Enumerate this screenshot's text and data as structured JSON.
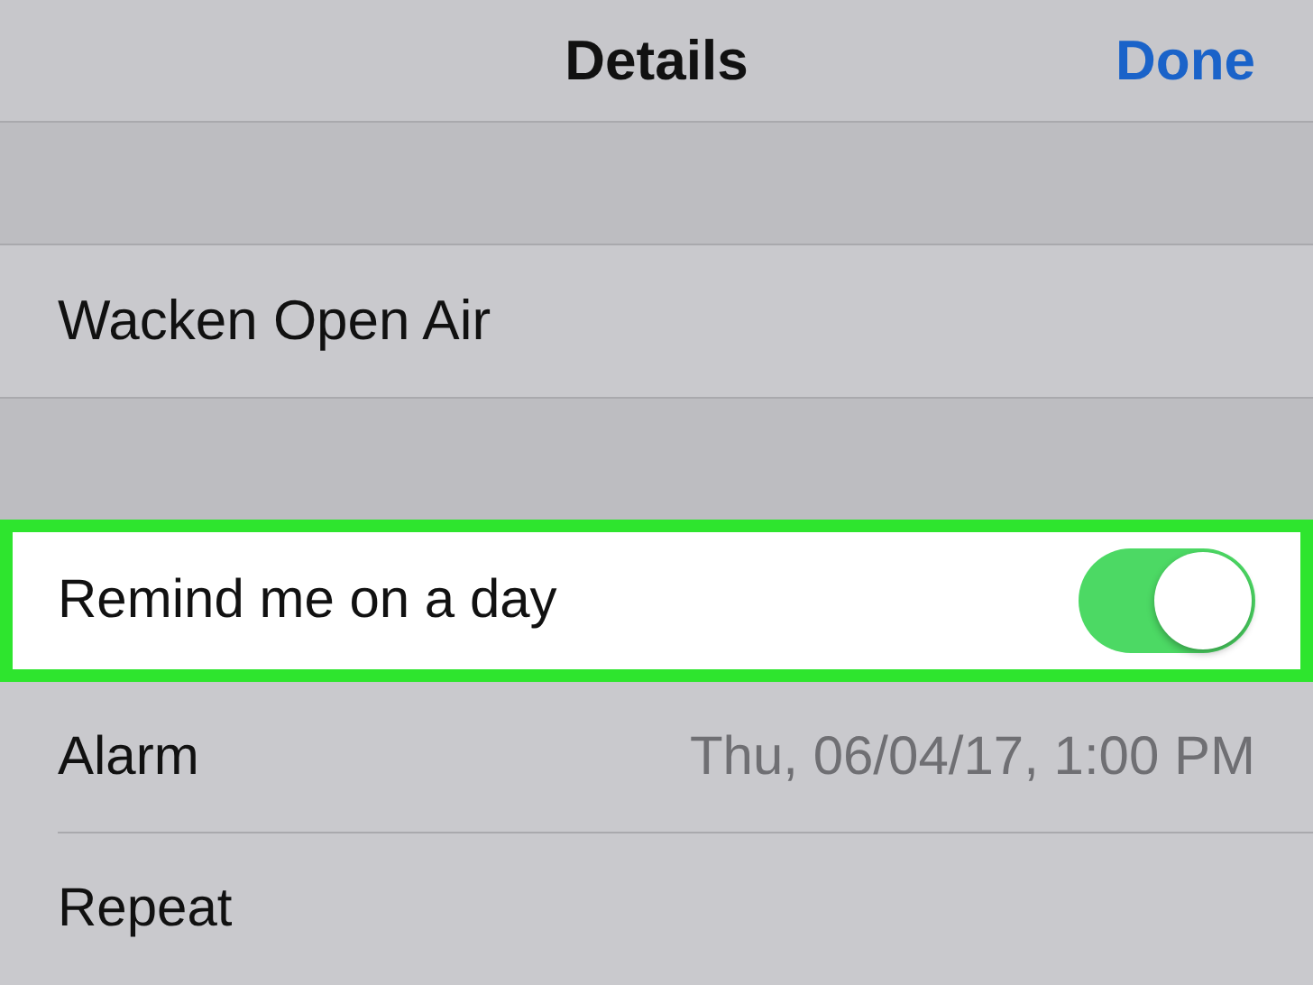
{
  "nav_bar": {
    "title": "Details",
    "done_button": "Done"
  },
  "title_row": {
    "text": "Wacken Open Air"
  },
  "rows": [
    {
      "kind": "toggle",
      "label": "Remind me on a day",
      "on": true,
      "highlighted": true
    },
    {
      "kind": "value",
      "label": "Alarm",
      "value": "Thu, 06/04/17, 1:00 PM",
      "highlighted": false
    },
    {
      "kind": "plain",
      "label": "Repeat",
      "highlighted": false
    }
  ]
}
